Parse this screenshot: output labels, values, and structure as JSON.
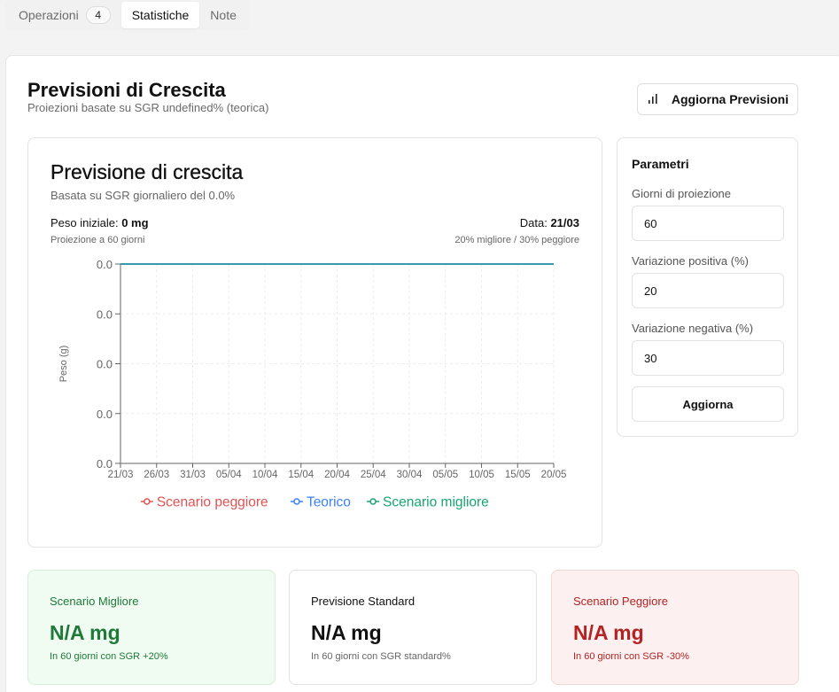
{
  "tabs": [
    {
      "label": "Operazioni",
      "count": "4",
      "active": false
    },
    {
      "label": "Statistiche",
      "active": true
    },
    {
      "label": "Note",
      "active": false
    }
  ],
  "header": {
    "title": "Previsioni di Crescita",
    "subtitle": "Proiezioni basate su SGR undefined% (teorica)",
    "refresh_label": "Aggiorna Previsioni",
    "refresh_icon": "bar-chart-icon"
  },
  "chart_card": {
    "title": "Previsione di crescita",
    "subtitle": "Basata su SGR giornaliero del 0.0%",
    "peso_label": "Peso iniziale: ",
    "peso_value": "0 mg",
    "proj_text": "Proiezione a 60 giorni",
    "data_label": "Data: ",
    "data_value": "21/03",
    "variation_text": "20% migliore / 30% peggiore"
  },
  "chart_data": {
    "type": "line",
    "ylabel": "Peso (g)",
    "xlabel": "",
    "x": [
      "21/03",
      "26/03",
      "31/03",
      "05/04",
      "10/04",
      "15/04",
      "20/04",
      "25/04",
      "30/04",
      "05/05",
      "10/05",
      "15/05",
      "20/05"
    ],
    "ytick_labels": [
      "0.0",
      "0.0",
      "0.0",
      "0.0",
      "0.0"
    ],
    "ylim": [
      0,
      1
    ],
    "grid": true,
    "legend_position": "bottom",
    "series": [
      {
        "name": "Scenario peggiore",
        "color": "#e05252",
        "values": [
          1,
          1,
          1,
          1,
          1,
          1,
          1,
          1,
          1,
          1,
          1,
          1,
          1
        ]
      },
      {
        "name": "Teorico",
        "color": "#3b82f6",
        "values": [
          1,
          1,
          1,
          1,
          1,
          1,
          1,
          1,
          1,
          1,
          1,
          1,
          1
        ]
      },
      {
        "name": "Scenario migliore",
        "color": "#16a672",
        "values": [
          1,
          1,
          1,
          1,
          1,
          1,
          1,
          1,
          1,
          1,
          1,
          1,
          1
        ]
      }
    ],
    "visible_line_color": "#1a9aa0"
  },
  "params": {
    "title": "Parametri",
    "fields": [
      {
        "label": "Giorni di proiezione",
        "value": "60"
      },
      {
        "label": "Variazione positiva (%)",
        "value": "20"
      },
      {
        "label": "Variazione negativa (%)",
        "value": "30"
      }
    ],
    "button_label": "Aggiorna"
  },
  "scenarios": {
    "best": {
      "title": "Scenario Migliore",
      "value": "N/A mg",
      "note": "In 60 giorni con SGR +20%"
    },
    "standard": {
      "title": "Previsione Standard",
      "value": "N/A mg",
      "note": "In 60 giorni con SGR standard%"
    },
    "worst": {
      "title": "Scenario Peggiore",
      "value": "N/A mg",
      "note": "In 60 giorni con SGR -30%"
    }
  }
}
